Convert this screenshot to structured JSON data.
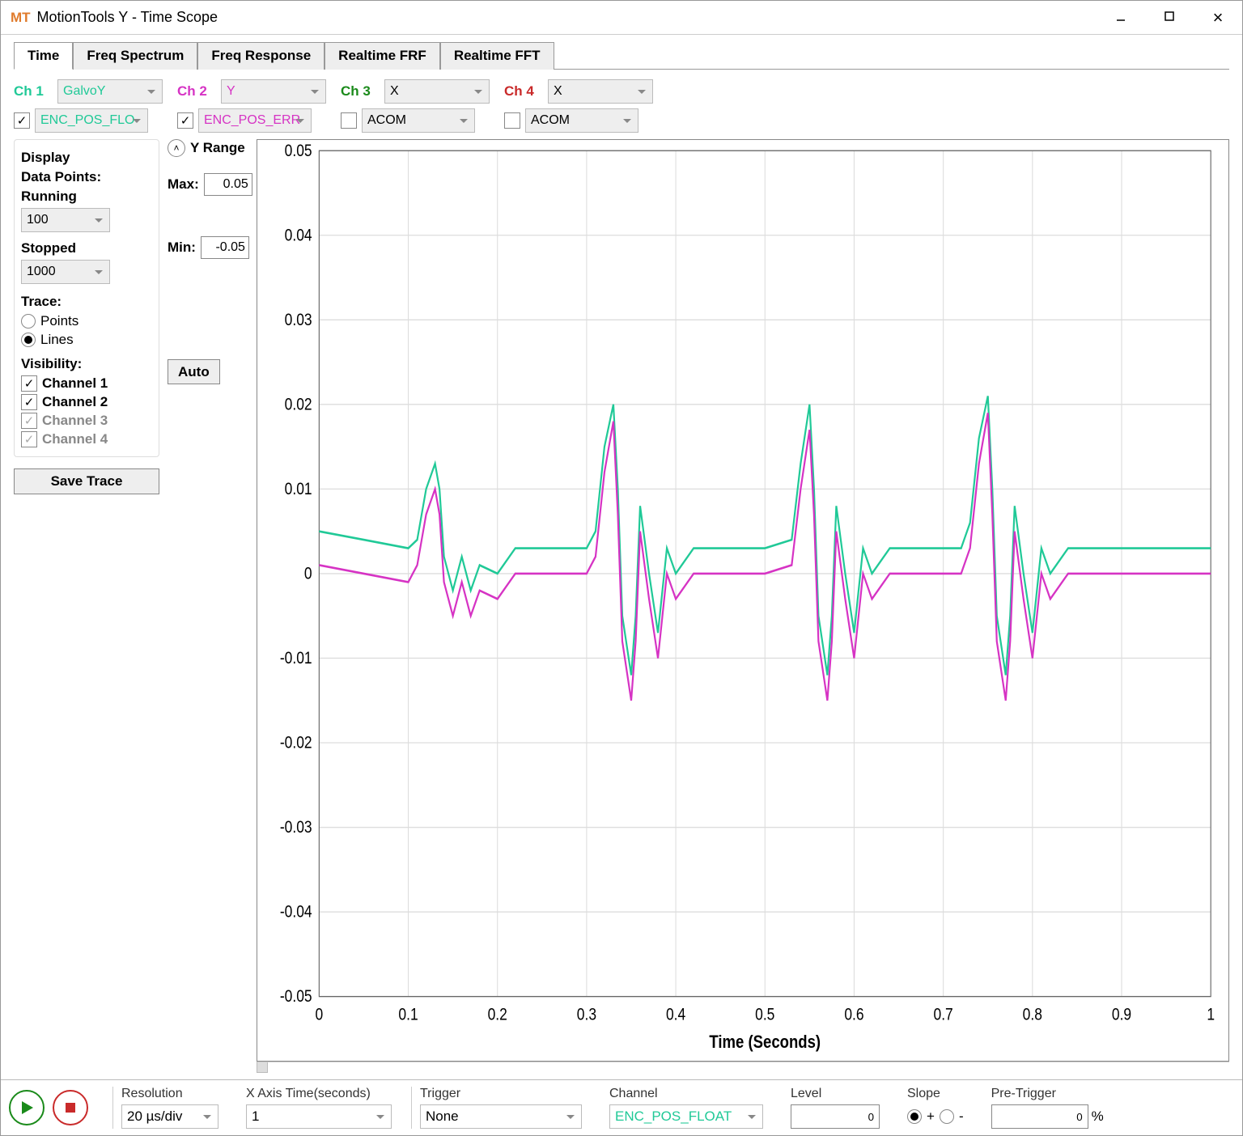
{
  "app": {
    "short": "MT",
    "title": "MotionTools Y - Time Scope"
  },
  "tabs": [
    "Time",
    "Freq Spectrum",
    "Freq Response",
    "Realtime FRF",
    "Realtime FFT"
  ],
  "channels": {
    "ch1": {
      "label": "Ch 1",
      "top": "GalvoY",
      "bot": "ENC_POS_FLO",
      "checked": true
    },
    "ch2": {
      "label": "Ch 2",
      "top": "Y",
      "bot": "ENC_POS_ERR",
      "checked": true
    },
    "ch3": {
      "label": "Ch 3",
      "top": "X",
      "bot": "ACOM",
      "checked": false
    },
    "ch4": {
      "label": "Ch 4",
      "top": "X",
      "bot": "ACOM",
      "checked": false
    }
  },
  "display": {
    "title": "Display",
    "datapoints": "Data Points:",
    "running_label": "Running",
    "running": "100",
    "stopped_label": "Stopped",
    "stopped": "1000",
    "trace_label": "Trace:",
    "points": "Points",
    "lines": "Lines",
    "visibility": "Visibility:",
    "ch1": "Channel 1",
    "ch2": "Channel 2",
    "ch3": "Channel 3",
    "ch4": "Channel 4",
    "save": "Save Trace"
  },
  "yrange": {
    "title": "Y Range",
    "max_label": "Max:",
    "max": "0.05",
    "min_label": "Min:",
    "min": "-0.05",
    "auto": "Auto"
  },
  "chart": {
    "xlabel": "Time (Seconds)"
  },
  "bottom": {
    "resolution": "Resolution",
    "resolution_val": "20 µs/div",
    "xaxis": "X Axis Time(seconds)",
    "xaxis_val": "1",
    "trigger": "Trigger",
    "trigger_val": "None",
    "channel": "Channel",
    "channel_val": "ENC_POS_FLOAT",
    "level": "Level",
    "level_val": "0",
    "slope": "Slope",
    "plus": "+",
    "minus": "-",
    "pretrigger": "Pre-Trigger",
    "pretrigger_val": "0",
    "pct": "%"
  },
  "chart_data": {
    "type": "line",
    "title": "",
    "xlabel": "Time (Seconds)",
    "ylabel": "",
    "xlim": [
      0,
      1
    ],
    "ylim": [
      -0.05,
      0.05
    ],
    "xticks": [
      0,
      0.1,
      0.2,
      0.3,
      0.4,
      0.5,
      0.6,
      0.7,
      0.8,
      0.9,
      1.0
    ],
    "yticks": [
      -0.05,
      -0.04,
      -0.03,
      -0.02,
      -0.01,
      0,
      0.01,
      0.02,
      0.03,
      0.04,
      0.05
    ],
    "series": [
      {
        "name": "Channel 1 (GalvoY ENC_POS_FLOAT)",
        "color": "#20c997",
        "x": [
          0,
          0.05,
          0.1,
          0.11,
          0.12,
          0.13,
          0.135,
          0.14,
          0.15,
          0.16,
          0.17,
          0.18,
          0.2,
          0.22,
          0.25,
          0.3,
          0.31,
          0.32,
          0.33,
          0.335,
          0.34,
          0.35,
          0.355,
          0.36,
          0.37,
          0.38,
          0.39,
          0.4,
          0.42,
          0.45,
          0.5,
          0.53,
          0.54,
          0.55,
          0.555,
          0.56,
          0.57,
          0.575,
          0.58,
          0.59,
          0.6,
          0.61,
          0.62,
          0.64,
          0.67,
          0.72,
          0.73,
          0.74,
          0.75,
          0.755,
          0.76,
          0.77,
          0.775,
          0.78,
          0.79,
          0.8,
          0.81,
          0.82,
          0.84,
          0.87,
          0.92,
          0.95,
          1.0
        ],
        "y": [
          0.005,
          0.004,
          0.003,
          0.004,
          0.01,
          0.013,
          0.01,
          0.002,
          -0.002,
          0.002,
          -0.002,
          0.001,
          0.0,
          0.003,
          0.003,
          0.003,
          0.005,
          0.015,
          0.02,
          0.01,
          -0.005,
          -0.012,
          -0.005,
          0.008,
          0.0,
          -0.007,
          0.003,
          0.0,
          0.003,
          0.003,
          0.003,
          0.004,
          0.013,
          0.02,
          0.01,
          -0.005,
          -0.012,
          -0.005,
          0.008,
          0.0,
          -0.007,
          0.003,
          0.0,
          0.003,
          0.003,
          0.003,
          0.006,
          0.016,
          0.021,
          0.01,
          -0.005,
          -0.012,
          -0.005,
          0.008,
          0.0,
          -0.007,
          0.003,
          0.0,
          0.003,
          0.003,
          0.003,
          0.003,
          0.003
        ]
      },
      {
        "name": "Channel 2 (Y ENC_POS_ERR)",
        "color": "#d633c4",
        "x": [
          0,
          0.05,
          0.1,
          0.11,
          0.12,
          0.13,
          0.135,
          0.14,
          0.15,
          0.16,
          0.17,
          0.18,
          0.2,
          0.22,
          0.25,
          0.3,
          0.31,
          0.32,
          0.33,
          0.335,
          0.34,
          0.35,
          0.355,
          0.36,
          0.37,
          0.38,
          0.39,
          0.4,
          0.42,
          0.45,
          0.5,
          0.53,
          0.54,
          0.55,
          0.555,
          0.56,
          0.57,
          0.575,
          0.58,
          0.59,
          0.6,
          0.61,
          0.62,
          0.64,
          0.67,
          0.72,
          0.73,
          0.74,
          0.75,
          0.755,
          0.76,
          0.77,
          0.775,
          0.78,
          0.79,
          0.8,
          0.81,
          0.82,
          0.84,
          0.87,
          0.92,
          0.95,
          1.0
        ],
        "y": [
          0.001,
          0.0,
          -0.001,
          0.001,
          0.007,
          0.01,
          0.007,
          -0.001,
          -0.005,
          -0.001,
          -0.005,
          -0.002,
          -0.003,
          0.0,
          0.0,
          0.0,
          0.002,
          0.012,
          0.018,
          0.007,
          -0.008,
          -0.015,
          -0.008,
          0.005,
          -0.003,
          -0.01,
          0.0,
          -0.003,
          0.0,
          0.0,
          0.0,
          0.001,
          0.01,
          0.017,
          0.007,
          -0.008,
          -0.015,
          -0.008,
          0.005,
          -0.003,
          -0.01,
          0.0,
          -0.003,
          0.0,
          0.0,
          0.0,
          0.003,
          0.013,
          0.019,
          0.007,
          -0.008,
          -0.015,
          -0.008,
          0.005,
          -0.003,
          -0.01,
          0.0,
          -0.003,
          0.0,
          0.0,
          0.0,
          0.0,
          0.0
        ]
      }
    ]
  }
}
